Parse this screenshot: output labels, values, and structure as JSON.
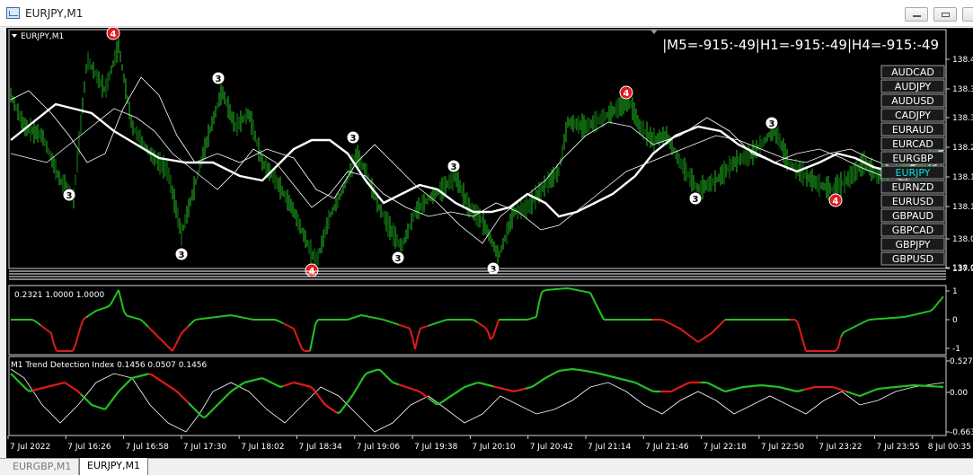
{
  "window": {
    "title": "EURJPY,M1"
  },
  "chart": {
    "symbol_label": "EURJPY,M1",
    "timeframe_info": "|M5=-915:-49|H1=-915:-49|H4=-915:-49",
    "price_ticks": [
      "138.4",
      "138.3",
      "138.3",
      "138.2",
      "138.1",
      "138.1",
      "138.0",
      "138.0",
      "137.9"
    ],
    "symbols": [
      "AUDCAD",
      "AUDJPY",
      "AUDUSD",
      "CADJPY",
      "EURAUD",
      "EURCAD",
      "EURGBP",
      "EURJPY",
      "EURNZD",
      "EURUSD",
      "GBPAUD",
      "GBPCAD",
      "GBPJPY",
      "GBPUSD"
    ],
    "active_symbol": "EURJPY",
    "markers": [
      "3",
      "4"
    ]
  },
  "colors": {
    "bull": "#22c322",
    "bear": "#e01b1b",
    "active_symbol": "#00e5e5",
    "main_line": "#ffffff"
  },
  "indicator1": {
    "label": "0.2321 1.0000 1.0000",
    "ticks": [
      "1",
      "0",
      "-1"
    ]
  },
  "indicator2": {
    "label": "M1 Trend Detection Index 0.1456 0.0507 0.1456",
    "ticks": [
      "0.527",
      "0.00",
      "-0.663"
    ]
  },
  "time_axis": [
    "7 Jul 2022",
    "7 Jul 16:26",
    "7 Jul 16:58",
    "7 Jul 17:30",
    "7 Jul 18:02",
    "7 Jul 18:34",
    "7 Jul 19:06",
    "7 Jul 19:38",
    "7 Jul 20:10",
    "7 Jul 20:42",
    "7 Jul 21:14",
    "7 Jul 21:46",
    "7 Jul 22:18",
    "7 Jul 22:50",
    "7 Jul 23:22",
    "7 Jul 23:55",
    "8 Jul 00:35"
  ],
  "tabs": [
    {
      "label": "EURGBP,M1"
    },
    {
      "label": "EURJPY,M1"
    }
  ]
}
